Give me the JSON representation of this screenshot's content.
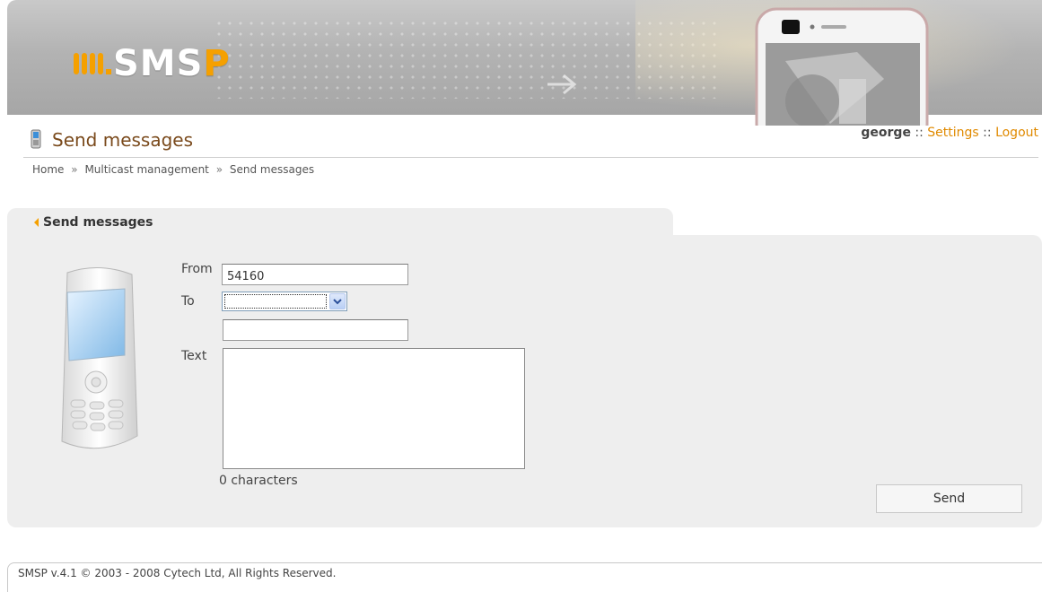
{
  "header": {
    "logo_main": "SMS",
    "logo_accent": "P"
  },
  "page": {
    "title": "Send messages"
  },
  "user": {
    "name": "george",
    "separator": "::",
    "settings_label": "Settings",
    "logout_label": "Logout"
  },
  "breadcrumb": {
    "items": [
      "Home",
      "Multicast management",
      "Send messages"
    ],
    "separator": "»"
  },
  "panel": {
    "title": "Send messages"
  },
  "form": {
    "from_label": "From",
    "from_value": "54160",
    "to_label": "To",
    "to_selected": "",
    "to_extra_value": "",
    "text_label": "Text",
    "text_value": "",
    "char_count": "0 characters",
    "send_label": "Send"
  },
  "footer": {
    "copyright": "SMSP v.4.1 © 2003 - 2008 Cytech Ltd, All Rights Reserved."
  },
  "colors": {
    "title": "#7a4a1c",
    "link": "#e08a00",
    "logo_accent": "#f5a000",
    "panel_bg": "#eeeeee"
  }
}
